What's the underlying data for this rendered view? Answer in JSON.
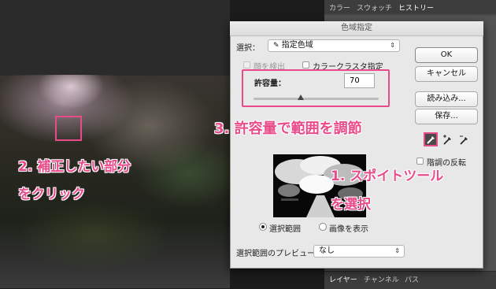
{
  "right_panel": {
    "tabs": [
      "カラー",
      "スウォッチ",
      "ヒストリー"
    ],
    "bottom_tabs": [
      "レイヤー",
      "チャンネル",
      "パス"
    ]
  },
  "dialog": {
    "title": "色域指定",
    "select_label": "選択：",
    "select_value": "指定色域",
    "detect_faces_label": "顔を検出",
    "localized_clusters_label": "カラークラスタ指定",
    "fuzziness_label": "許容量：",
    "fuzziness_value": "70",
    "fuzziness_fraction": 0.38,
    "ok_label": "OK",
    "cancel_label": "キャンセル",
    "load_label": "読み込み...",
    "save_label": "保存...",
    "invert_label": "階調の反転",
    "radio_selection_label": "選択範囲",
    "radio_image_label": "画像を表示",
    "preview_label": "選択範囲のプレビュー：",
    "preview_value": "なし"
  },
  "annotations": {
    "step1": "1. スポイトツール",
    "step1b": "を選択",
    "step2": "2. 補正したい部分",
    "step2b": "をクリック",
    "step3": "3. 許容量で範囲を調節"
  },
  "colors": {
    "accent": "#e94b8a"
  }
}
